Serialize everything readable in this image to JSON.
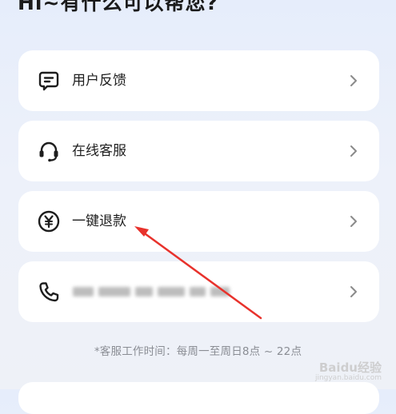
{
  "header": {
    "greeting": "Hi~有什么可以帮您?"
  },
  "menu": {
    "items": [
      {
        "label": "用户反馈",
        "icon": "feedback-chat-icon"
      },
      {
        "label": "在线客服",
        "icon": "headset-icon"
      },
      {
        "label": "一键退款",
        "icon": "yuan-refund-icon"
      },
      {
        "label": "",
        "icon": "phone-icon",
        "value_redacted": true
      }
    ]
  },
  "footer": {
    "service_hours": "*客服工作时间：每周一至周日8点 ~ 22点"
  },
  "watermark": {
    "text": "Baidu经验",
    "url": "jingyan.baidu.com"
  },
  "colors": {
    "background": "#e6edfb",
    "card": "#ffffff",
    "annotation_arrow": "#e8322c",
    "footer_text": "#8a8d94"
  }
}
